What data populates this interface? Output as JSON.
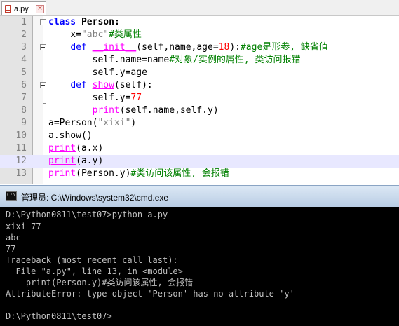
{
  "editor": {
    "tab_label": "a.py",
    "lines": [
      {
        "n": "1"
      },
      {
        "n": "2"
      },
      {
        "n": "3"
      },
      {
        "n": "4"
      },
      {
        "n": "5"
      },
      {
        "n": "6"
      },
      {
        "n": "7"
      },
      {
        "n": "8"
      },
      {
        "n": "9"
      },
      {
        "n": "10"
      },
      {
        "n": "11"
      },
      {
        "n": "12"
      },
      {
        "n": "13"
      }
    ],
    "code": {
      "l1": {
        "kw": "class",
        "name": "Person",
        "colon": ":"
      },
      "l2": {
        "pre": "x=",
        "str": "\"abc\"",
        "cm": "#类属性"
      },
      "l3": {
        "kw": "def",
        "fn": "__init__",
        "args": "(self,name,age=",
        "num": "18",
        "close": "):",
        "cm": "#age是形参, 缺省值"
      },
      "l4": {
        "code": "self.name=name",
        "cm": "#对象/实例的属性, 类访问报错"
      },
      "l5": {
        "code": "self.y=age"
      },
      "l6": {
        "kw": "def",
        "fn": "show",
        "args": "(self):"
      },
      "l7": {
        "pre": "self.y=",
        "num": "77"
      },
      "l8": {
        "kw": "print",
        "args": "(self.name,self.y)"
      },
      "l9": {
        "pre": "a=Person(",
        "str": "\"xixi\"",
        "close": ")"
      },
      "l10": {
        "code": "a.show()"
      },
      "l11": {
        "kw": "print",
        "args": "(a.x)"
      },
      "l12": {
        "kw": "print",
        "args": "(a.y)"
      },
      "l13": {
        "kw": "print",
        "args": "(Person.y)",
        "cm": "#类访问该属性, 会报错"
      }
    },
    "current_line": "12"
  },
  "cmd": {
    "title": "管理员: C:\\Windows\\system32\\cmd.exe",
    "output": [
      "D:\\Python0811\\test07>python a.py",
      "xixi 77",
      "abc",
      "77",
      "Traceback (most recent call last):",
      "  File \"a.py\", line 13, in <module>",
      "    print(Person.y)#类访问该属性, 会报错",
      "AttributeError: type object 'Person' has no attribute 'y'",
      "",
      "D:\\Python0811\\test07>"
    ]
  },
  "colors": {
    "keyword": "#0000ff",
    "string": "#808080",
    "number": "#ff0000",
    "comment": "#008000",
    "current_line_bg": "#e8e8ff",
    "console_bg": "#000000",
    "console_fg": "#c0c0c0"
  }
}
